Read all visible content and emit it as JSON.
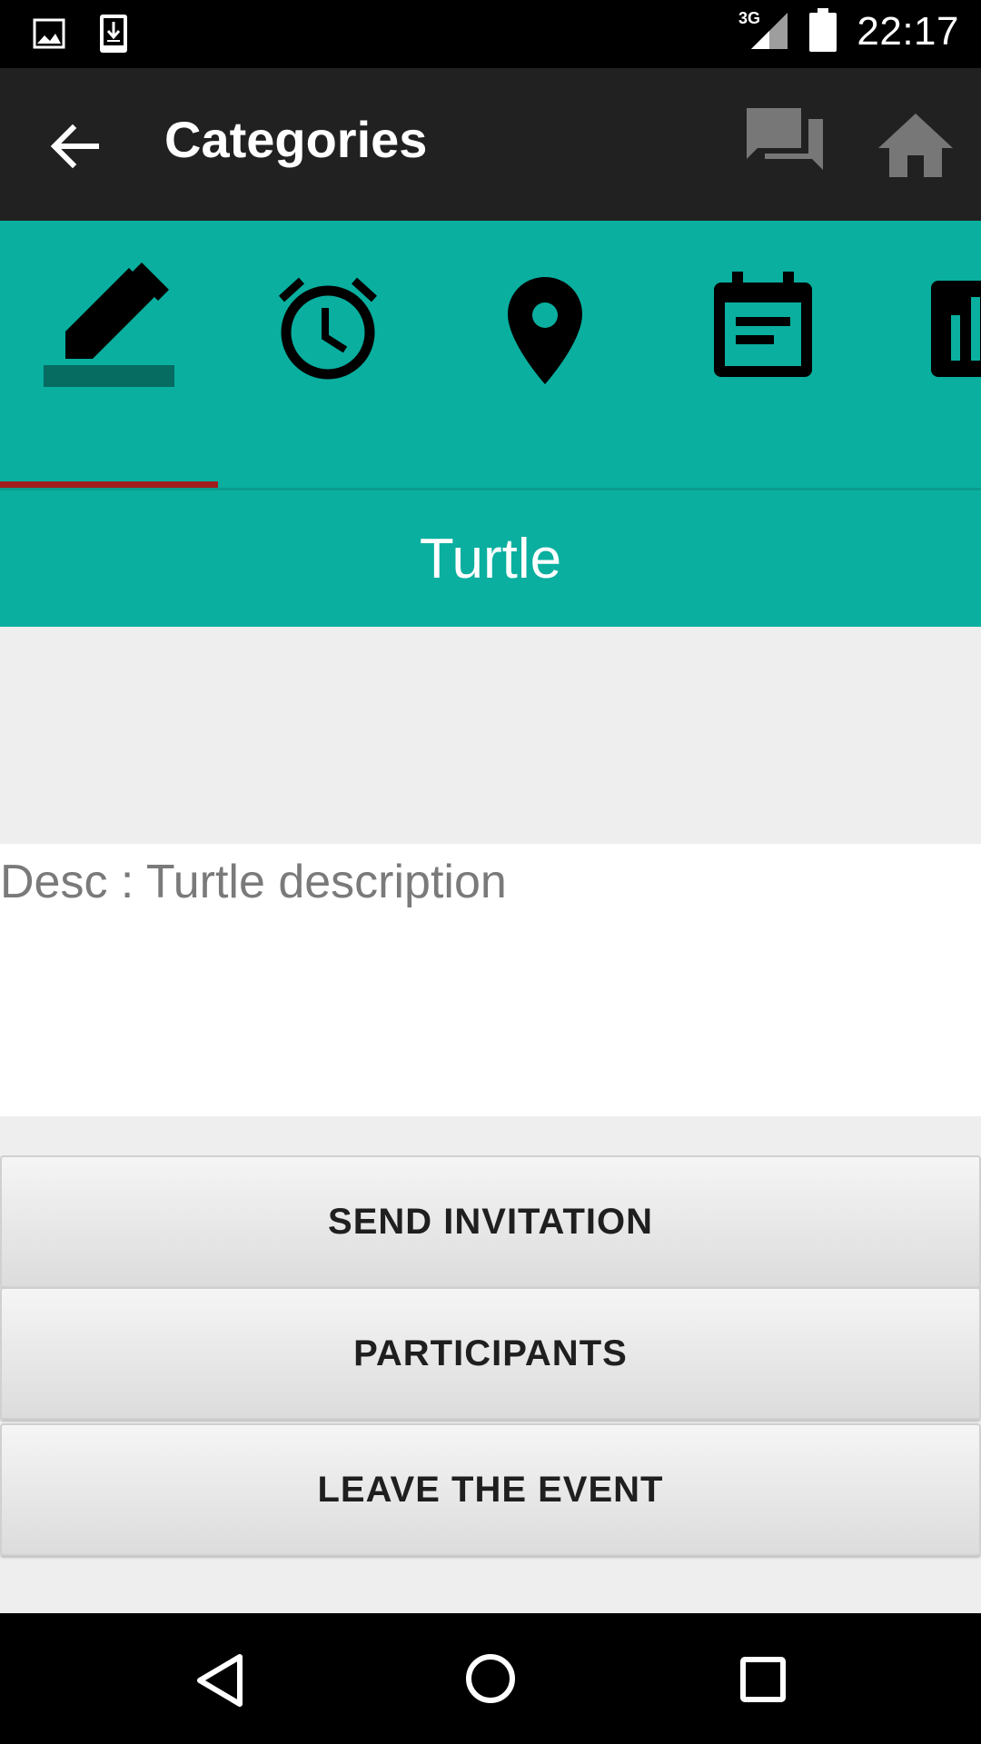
{
  "status_bar": {
    "time": "22:17",
    "network": "3G",
    "icons": [
      "image-icon",
      "download-icon",
      "signal-3g-icon",
      "battery-icon"
    ]
  },
  "app_bar": {
    "title": "Categories",
    "back_icon": "arrow-back-icon",
    "actions": [
      "chat-icon",
      "home-icon"
    ]
  },
  "tabs": [
    {
      "icon": "edit-icon",
      "selected": true
    },
    {
      "icon": "alarm-icon",
      "selected": false
    },
    {
      "icon": "location-pin-icon",
      "selected": false
    },
    {
      "icon": "calendar-note-icon",
      "selected": false
    },
    {
      "icon": "chart-bar-icon",
      "selected": false
    }
  ],
  "event": {
    "title": "Turtle",
    "description": "Desc : Turtle description"
  },
  "buttons": {
    "send_invitation": "SEND INVITATION",
    "participants": "PARTICIPANTS",
    "leave_event": "LEAVE THE EVENT"
  },
  "colors": {
    "accent": "#0aaf9f",
    "app_bar": "#212121",
    "tab_indicator": "#a01d1d"
  },
  "nav_bar": {
    "icons": [
      "back-triangle-icon",
      "home-circle-icon",
      "recents-square-icon"
    ]
  }
}
